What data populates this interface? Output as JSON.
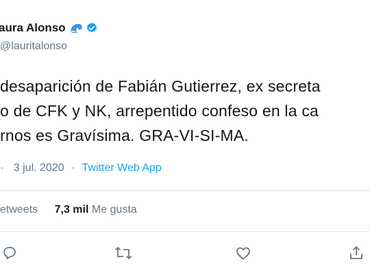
{
  "author": {
    "display_name": "aura Alonso",
    "handle": "@lauritalonso",
    "verified": true
  },
  "tweet": {
    "lines": [
      "desaparición de Fabián Gutierrez, ex secreta",
      "o de CFK y NK, arrepentido confeso en la ca",
      "rnos es Gravísima. GRA-VI-SI-MA."
    ],
    "time_partial": "·",
    "date": "3 jul. 2020",
    "source": "Twitter Web App"
  },
  "stats": {
    "retweets_label": "etweets",
    "likes_count": "7,3 mil",
    "likes_label": "Me gusta"
  },
  "icons": [
    "wave-emoji",
    "verified-badge",
    "reply-icon",
    "retweet-icon",
    "like-icon",
    "share-icon"
  ],
  "colors": {
    "accent": "#1da1f2",
    "text": "#14171a",
    "secondary": "#657786",
    "divider": "#e1e8ed"
  }
}
